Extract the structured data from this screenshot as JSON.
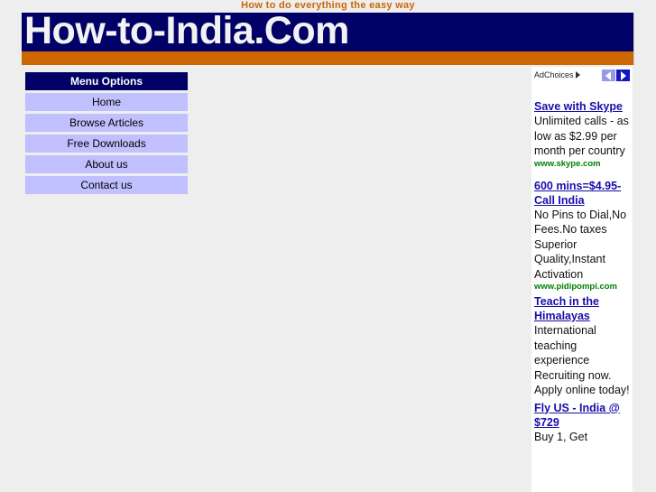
{
  "tagline": "How to do everything the easy way",
  "header": {
    "site_title": "How-to-India.Com"
  },
  "menu": {
    "heading": "Menu Options",
    "items": [
      {
        "label": "Home"
      },
      {
        "label": "Browse Articles"
      },
      {
        "label": "Free Downloads"
      },
      {
        "label": "About us"
      },
      {
        "label": "Contact us"
      }
    ]
  },
  "ads": {
    "adchoices_label": "AdChoices",
    "prev_label": "‹",
    "next_label": "›",
    "items": [
      {
        "title": "Save with Skype",
        "body": "Unlimited calls - as low as $2.99 per month per country",
        "url": "www.skype.com"
      },
      {
        "title": "600 mins=$4.95-Call India",
        "body": "No Pins to Dial,No Fees.No taxes Superior Quality,Instant Activation",
        "url": "www.pidipompi.com"
      },
      {
        "title": "Teach in the Himalayas",
        "body": "International teaching experience Recruiting now. Apply online today!",
        "url": ""
      },
      {
        "title": "Fly US - India @ $729",
        "body": "Buy 1, Get",
        "url": ""
      }
    ]
  },
  "colors": {
    "navy": "#000066",
    "orange": "#cc6600",
    "menu_item": "#c0c0ff",
    "page_bg": "#eeeeee",
    "link": "#1a0dab",
    "url_green": "#008000"
  }
}
